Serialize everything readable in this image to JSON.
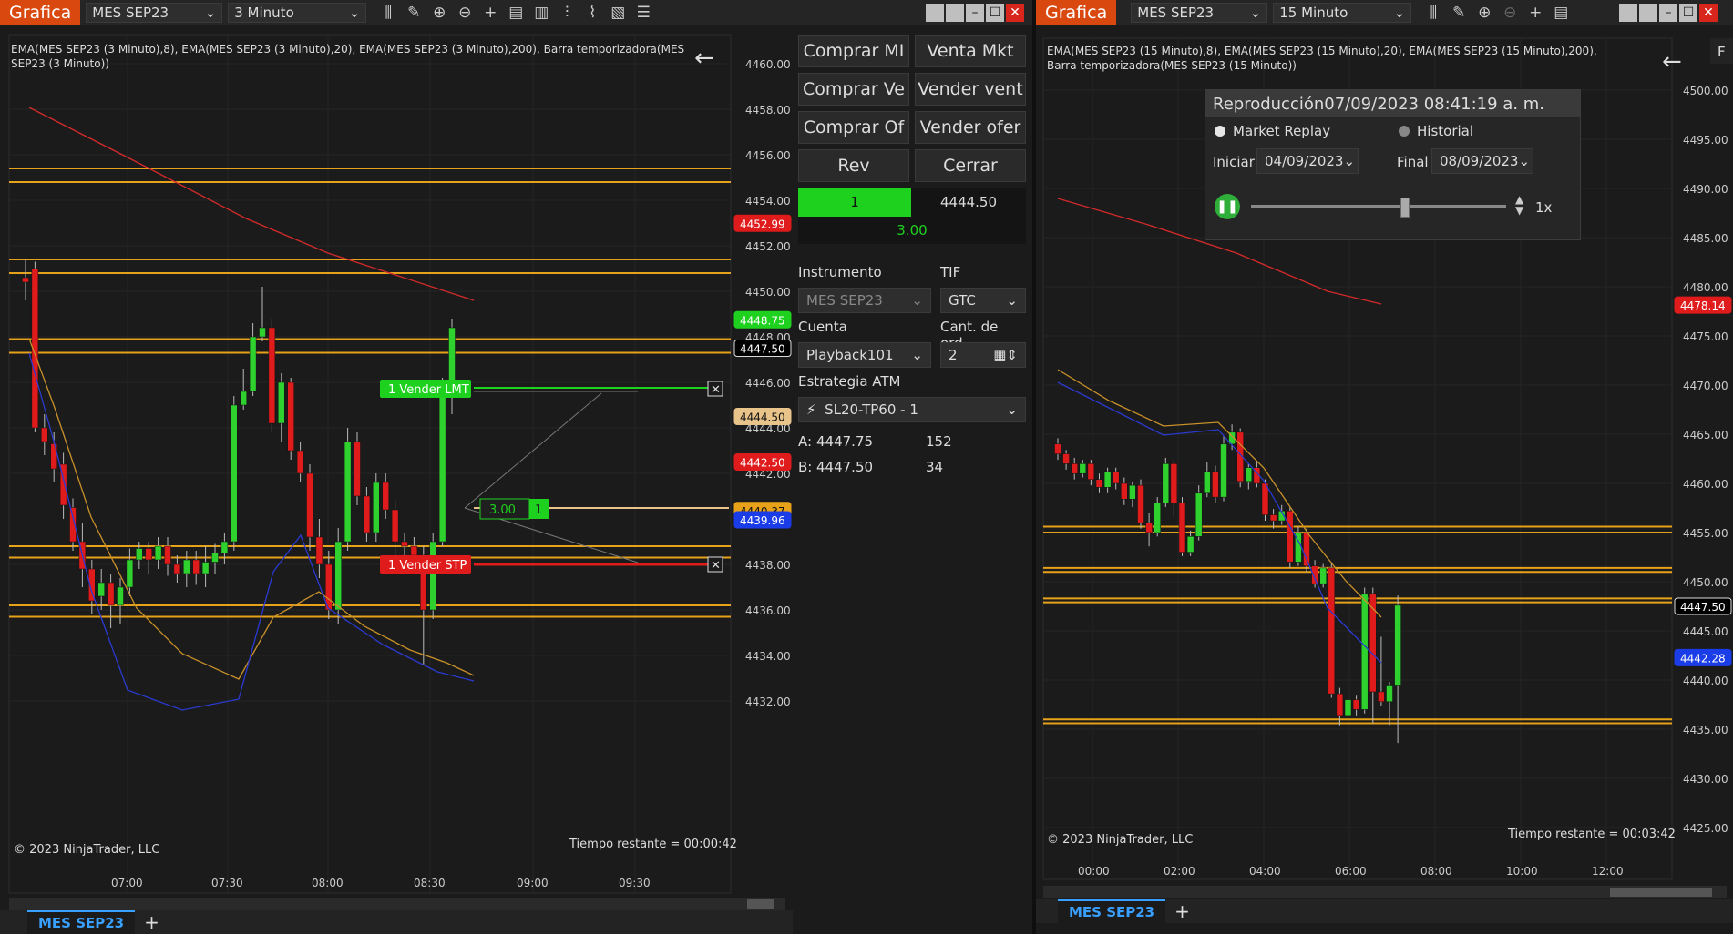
{
  "left_window": {
    "title": "Grafica",
    "instrument": "MES SEP23",
    "timeframe": "3 Minuto",
    "indicator_label": "EMA(MES SEP23 (3 Minuto),8), EMA(MES SEP23 (3 Minuto),20), EMA(MES SEP23 (3 Minuto),200), Barra temporizadora(MES SEP23 (3 Minuto))",
    "price_axis": [
      "4460.00",
      "4458.00",
      "4456.00",
      "4454.00",
      "4452.00",
      "4450.00",
      "4448.00",
      "4446.00",
      "4444.00",
      "4442.00",
      "4438.00",
      "4436.00",
      "4434.00",
      "4432.00"
    ],
    "time_axis": [
      "07:00",
      "07:30",
      "08:00",
      "08:30",
      "09:00",
      "09:30"
    ],
    "markers": [
      {
        "value": "4452.99",
        "color": "#e01b1b"
      },
      {
        "value": "4448.75",
        "color": "#1fd11f"
      },
      {
        "value": "4447.50",
        "color": "#000000"
      },
      {
        "value": "4444.50",
        "color": "#e8c38a"
      },
      {
        "value": "4442.50",
        "color": "#e01b1b"
      },
      {
        "value": "4440.37",
        "color": "#e7a21a"
      },
      {
        "value": "4439.96",
        "color": "#1a3de8"
      }
    ],
    "order_lmt": "1  Vender LMT",
    "order_stp": "1  Vender STP",
    "position_qty": "3.00",
    "position_count": "1",
    "copyright": "© 2023 NinjaTrader, LLC",
    "time_remaining": "Tiempo restante = 00:00:42",
    "tab": "MES SEP23"
  },
  "order_panel": {
    "buttons": [
      "Comprar MI",
      "Venta Mkt",
      "Comprar Ve",
      "Vender vent",
      "Comprar Of",
      "Vender ofer",
      "Rev",
      "Cerrar"
    ],
    "position_qty": "1",
    "position_price": "4444.50",
    "pnl": "3.00",
    "instrument_label": "Instrumento",
    "instrument_value": "MES SEP23",
    "tif_label": "TIF",
    "tif_value": "GTC",
    "account_label": "Cuenta",
    "account_value": "Playback101",
    "qty_label": "Cant. de ord...",
    "qty_value": "2",
    "atm_label": "Estrategia ATM",
    "atm_value": "SL20-TP60 - 1",
    "ask_label": "A:",
    "ask_price": "4447.75",
    "ask_size": "152",
    "bid_label": "B:",
    "bid_price": "4447.50",
    "bid_size": "34"
  },
  "right_window": {
    "title": "Grafica",
    "instrument": "MES SEP23",
    "timeframe": "15 Minuto",
    "indicator_label": "EMA(MES SEP23 (15 Minuto),8), EMA(MES SEP23 (15 Minuto),20), EMA(MES SEP23 (15 Minuto),200), Barra temporizadora(MES SEP23 (15 Minuto))",
    "price_axis": [
      "4500.00",
      "4495.00",
      "4490.00",
      "4485.00",
      "4480.00",
      "4475.00",
      "4470.00",
      "4465.00",
      "4460.00",
      "4455.00",
      "4450.00",
      "4445.00",
      "4440.00",
      "4435.00",
      "4430.00",
      "4425.00"
    ],
    "time_axis": [
      "00:00",
      "02:00",
      "04:00",
      "06:00",
      "08:00",
      "10:00",
      "12:00"
    ],
    "markers": [
      {
        "value": "4478.14",
        "color": "#e01b1b"
      },
      {
        "value": "4447.50",
        "color": "#000000"
      },
      {
        "value": "4442.28",
        "color": "#1a3de8"
      }
    ],
    "copyright": "© 2023 NinjaTrader, LLC",
    "time_remaining": "Tiempo restante = 00:03:42",
    "tab": "MES SEP23",
    "corner_label": "F"
  },
  "replay": {
    "title": "Reproducción07/09/2023 08:41:19 a. m.",
    "market_replay": "Market Replay",
    "historical": "Historial",
    "start_label": "Iniciar",
    "start_date": "04/09/2023",
    "end_label": "Final",
    "end_date": "08/09/2023",
    "speed": "1x"
  }
}
